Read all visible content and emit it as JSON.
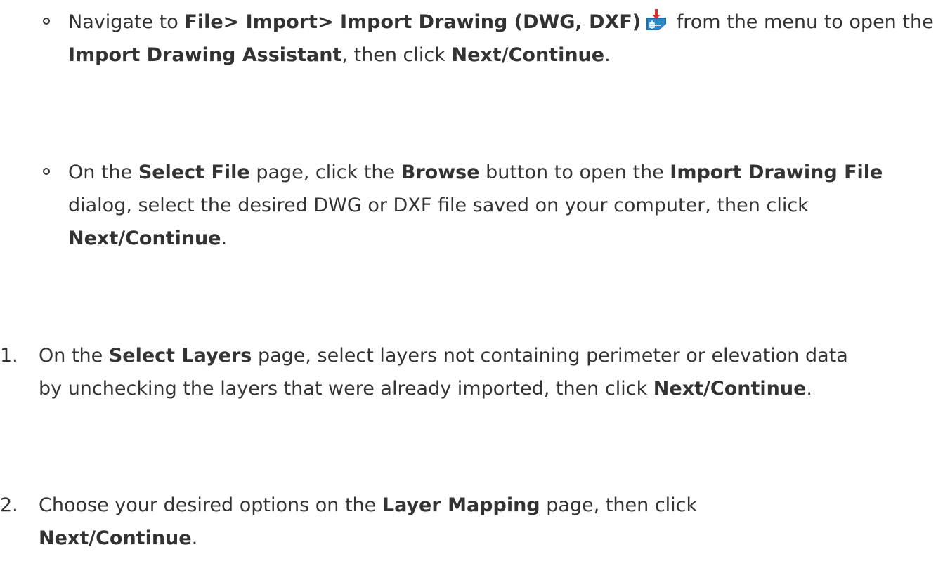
{
  "steps_bullets": [
    {
      "t1": "Navigate to ",
      "b1": "File> Import> Import Drawing (DWG, DXF)",
      "t2": " from the menu to open the ",
      "b2": "Import Drawing Assistant",
      "t3": ", then click ",
      "b3": "Next/Continue",
      "t4": ".",
      "icon": "import-drawing-icon"
    },
    {
      "t1": "On the ",
      "b1": "Select File",
      "t2": " page, click the ",
      "b2": "Browse",
      "t3": " button to open the ",
      "b3": "Import Drawing File",
      "t4": " dialog, select the desired DWG or DXF file saved on your computer, then click ",
      "b4": "Next/Continue",
      "t5": "."
    }
  ],
  "steps_numbered": [
    {
      "num": "1.",
      "t1": "On the ",
      "b1": "Select Layers",
      "t2": " page, select layers not containing perimeter or elevation data by unchecking the layers that were already imported, then click ",
      "b2": "Next/Continue",
      "t3": "."
    },
    {
      "num": "2.",
      "t1": "Choose your desired options on the ",
      "b1": "Layer Mapping",
      "t2": " page, then click ",
      "b2": "Next/Continue",
      "t3": "."
    }
  ],
  "colors": {
    "text": "#333333",
    "icon_blue": "#1a6ea8",
    "icon_red": "#d9302c"
  }
}
